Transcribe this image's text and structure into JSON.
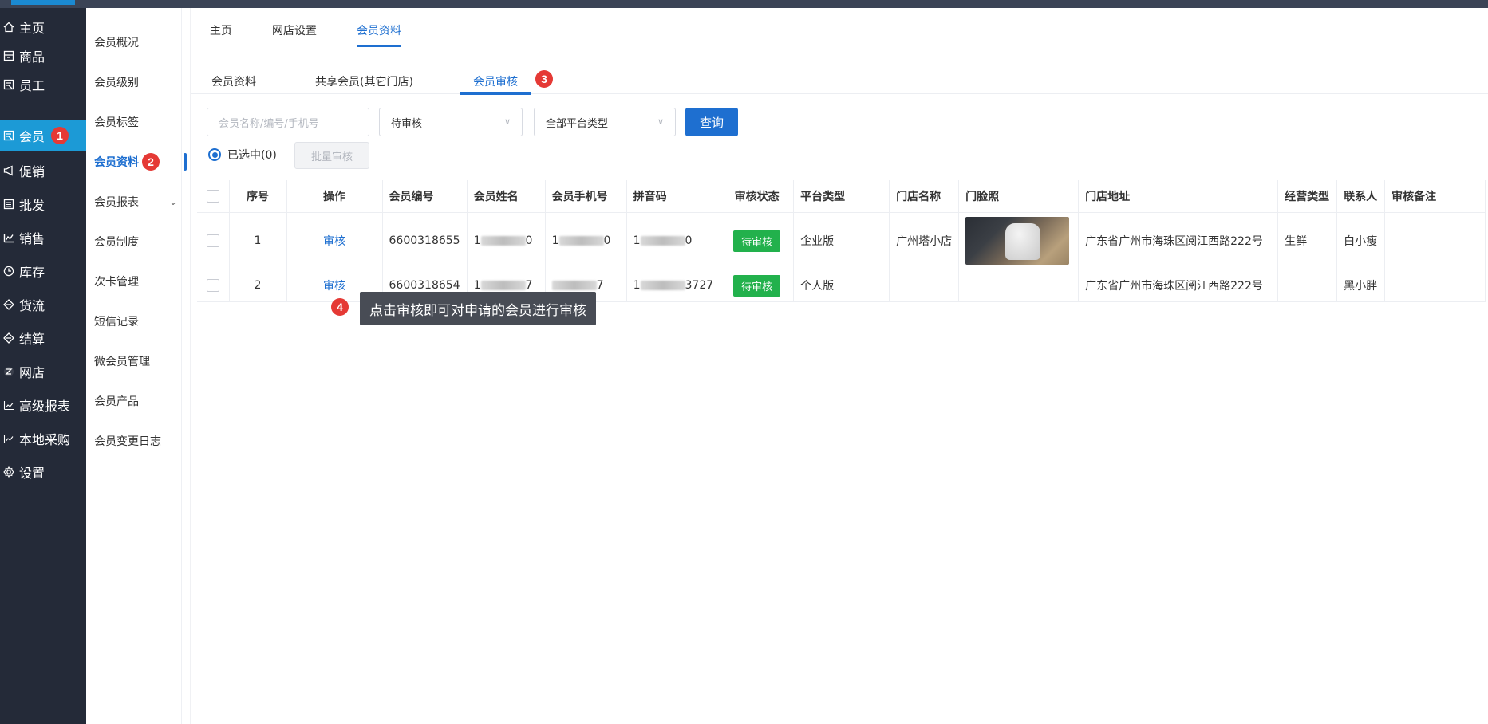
{
  "sidebar": {
    "items": [
      {
        "label": "主页",
        "icon": "home-icon"
      },
      {
        "label": "商品",
        "icon": "goods-icon"
      },
      {
        "label": "员工",
        "icon": "staff-icon"
      },
      {
        "label": "会员",
        "icon": "member-icon",
        "badge": "1"
      },
      {
        "label": "促销",
        "icon": "megaphone-icon"
      },
      {
        "label": "批发",
        "icon": "wholesale-icon"
      },
      {
        "label": "销售",
        "icon": "sales-chart-icon"
      },
      {
        "label": "库存",
        "icon": "clock-icon"
      },
      {
        "label": "货流",
        "icon": "flow-icon"
      },
      {
        "label": "结算",
        "icon": "settle-icon"
      },
      {
        "label": "网店",
        "icon": "shop-icon"
      },
      {
        "label": "高级报表",
        "icon": "report-icon"
      },
      {
        "label": "本地采购",
        "icon": "purchase-icon"
      },
      {
        "label": "设置",
        "icon": "gear-icon"
      }
    ]
  },
  "submenu": {
    "items": [
      {
        "label": "会员概况"
      },
      {
        "label": "会员级别"
      },
      {
        "label": "会员标签"
      },
      {
        "label": "会员资料",
        "badge": "2"
      },
      {
        "label": "会员报表"
      },
      {
        "label": "会员制度"
      },
      {
        "label": "次卡管理"
      },
      {
        "label": "短信记录"
      },
      {
        "label": "微会员管理"
      },
      {
        "label": "会员产品"
      },
      {
        "label": "会员变更日志"
      }
    ]
  },
  "toptabs": [
    "主页",
    "网店设置",
    "会员资料"
  ],
  "subtabs": {
    "items": [
      "会员资料",
      "共享会员(其它门店)",
      "会员审核"
    ],
    "badge": "3"
  },
  "filters": {
    "search_placeholder": "会员名称/编号/手机号",
    "status": "待审核",
    "platform": "全部平台类型",
    "query_label": "查询",
    "selected_label": "已选中(0)",
    "batch_label": "批量审核"
  },
  "table": {
    "headers": [
      "序号",
      "操作",
      "会员编号",
      "会员姓名",
      "会员手机号",
      "拼音码",
      "审核状态",
      "平台类型",
      "门店名称",
      "门脸照",
      "门店地址",
      "经营类型",
      "联系人",
      "审核备注"
    ],
    "rows": [
      {
        "no": "1",
        "action": "审核",
        "member_id": "6600318655",
        "name_prefix": "1",
        "name_suffix": "0",
        "phone_prefix": "1",
        "phone_suffix": "0",
        "pinyin_prefix": "1",
        "pinyin_suffix": "0",
        "status": "待审核",
        "platform": "企业版",
        "store": "广州塔小店",
        "address": "广东省广州市海珠区阅江西路222号",
        "biz_type": "生鲜",
        "contact": "白小瘦",
        "remark": ""
      },
      {
        "no": "2",
        "action": "审核",
        "member_id": "6600318654",
        "name_prefix": "1",
        "name_suffix": "7",
        "phone_prefix": "",
        "phone_suffix": "7",
        "pinyin_prefix": "1",
        "pinyin_suffix": "3727",
        "status": "待审核",
        "platform": "个人版",
        "store": "",
        "address": "广东省广州市海珠区阅江西路222号",
        "biz_type": "",
        "contact": "黑小胖",
        "remark": ""
      }
    ]
  },
  "tooltip": {
    "badge": "4",
    "text": "点击审核即可对申请的会员进行审核"
  },
  "colors": {
    "primary": "#1e6fd0",
    "sidebar_bg": "#242a38",
    "active_nav": "#1c9ad6",
    "badge": "#e53935",
    "status_tag": "#22b14c"
  }
}
